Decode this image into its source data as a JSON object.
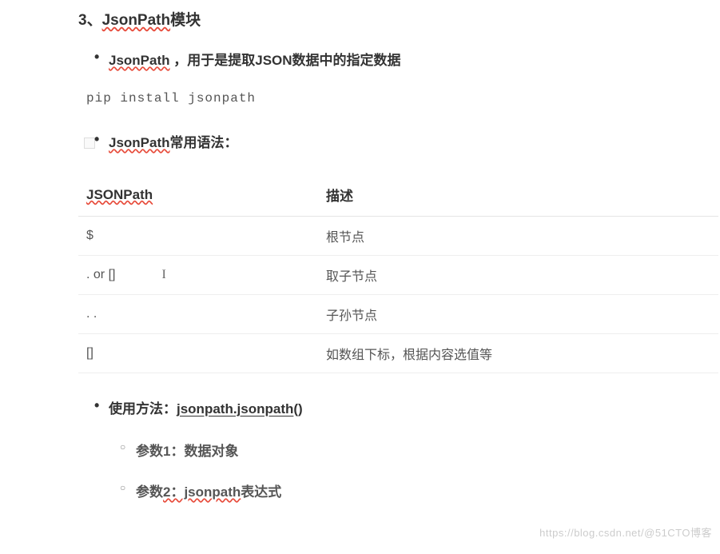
{
  "heading": {
    "prefix": "3、",
    "underlined": "JsonPath",
    "suffix": "模块"
  },
  "bullets": {
    "b1_underlined": "JsonPath",
    "b1_rest": " ，用于是提取JSON数据中的指定数据",
    "code": "pip install jsonpath",
    "b2_underlined": "JsonPath",
    "b2_rest": "常用语法：",
    "b3_prefix": "使用方法：",
    "b3_underlined": "jsonpath.jsonpath",
    "b3_suffix": "()"
  },
  "table": {
    "headers": {
      "col1": "JSONPath",
      "col2": "描述"
    },
    "rows": [
      {
        "c1": "$",
        "c2": "根节点"
      },
      {
        "c1": ". or []",
        "c2": "取子节点"
      },
      {
        "c1": ". .",
        "c2": "子孙节点"
      },
      {
        "c1": "[]",
        "c2": "如数组下标，根据内容选值等"
      }
    ]
  },
  "sub_bullets": {
    "s1_prefix": "参数1：",
    "s1_rest": "数据对象",
    "s2_prefix_a": "参数",
    "s2_underlined": "2：jsonpath",
    "s2_rest": "表达式"
  },
  "cursor": "I",
  "watermark": "https://blog.csdn.net/@51CTO博客"
}
